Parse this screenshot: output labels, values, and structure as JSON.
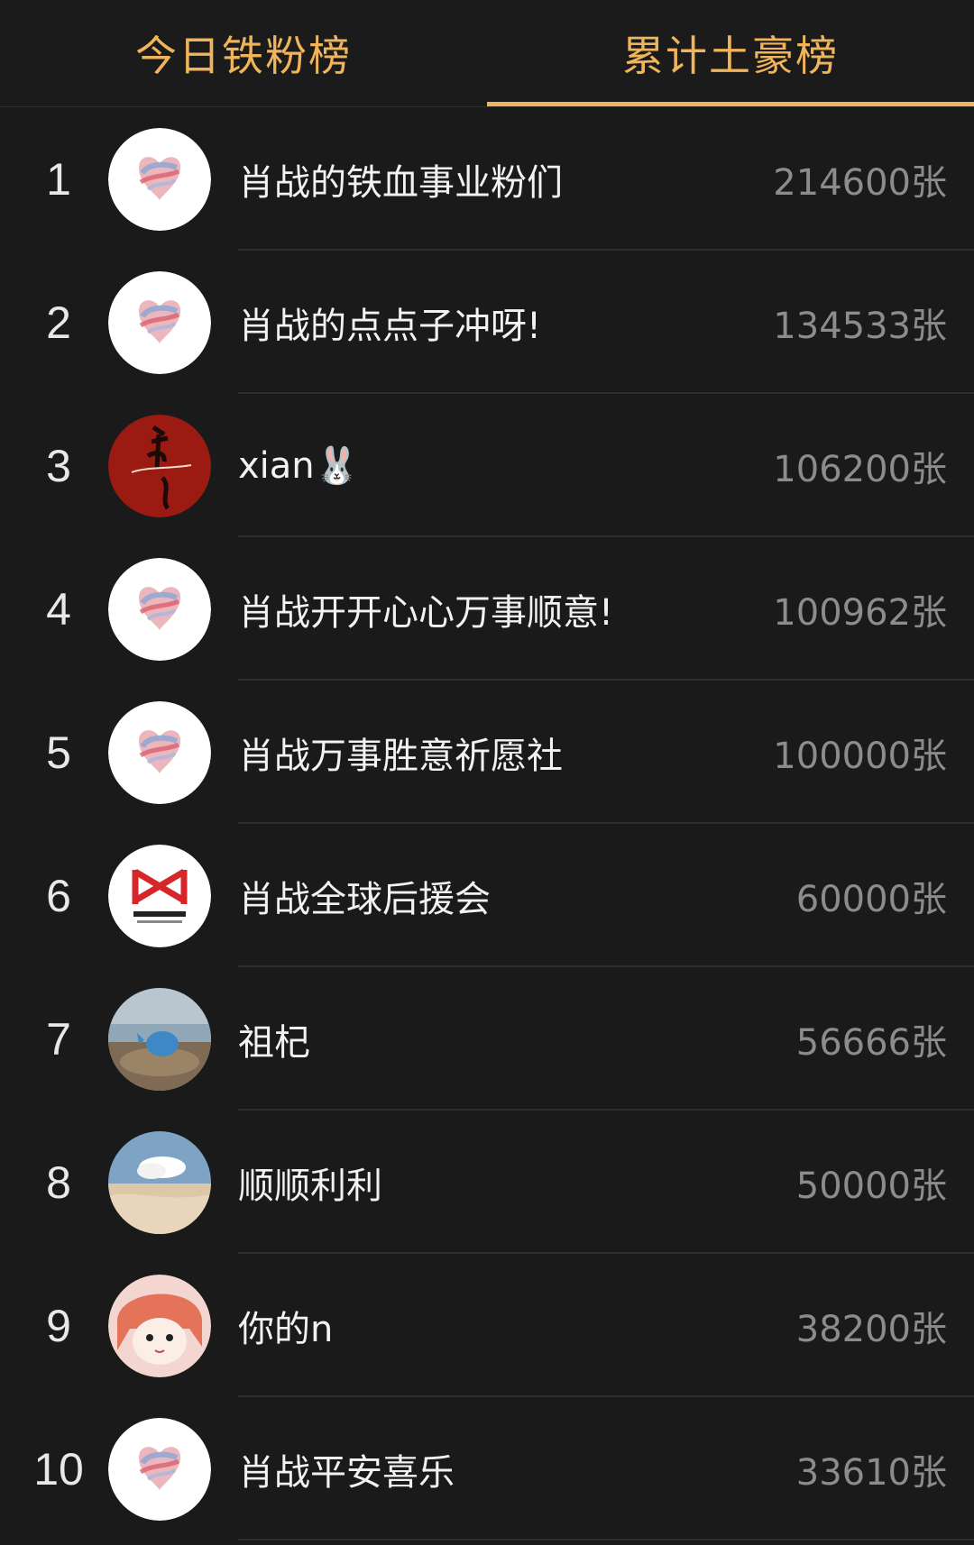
{
  "tabs": [
    {
      "label": "今日铁粉榜",
      "active": false
    },
    {
      "label": "累计土豪榜",
      "active": true
    }
  ],
  "colors": {
    "accent": "#f0b55a",
    "background": "#1a1a1a",
    "name_text": "#f2f2f2",
    "amount_text": "#8c8c8c"
  },
  "rows": [
    {
      "rank": "1",
      "name": "肖战的铁血事业粉们",
      "amount": "214600张",
      "avatar": "heart-logo-avatar"
    },
    {
      "rank": "2",
      "name": "肖战的点点子冲呀!",
      "amount": "134533张",
      "avatar": "heart-logo-avatar"
    },
    {
      "rank": "3",
      "name": "xian🐰",
      "amount": "106200张",
      "avatar": "red-calligraphy-avatar"
    },
    {
      "rank": "4",
      "name": "肖战开开心心万事顺意!",
      "amount": "100962张",
      "avatar": "heart-logo-avatar"
    },
    {
      "rank": "5",
      "name": "肖战万事胜意祈愿社",
      "amount": "100000张",
      "avatar": "heart-logo-avatar"
    },
    {
      "rank": "6",
      "name": "肖战全球后援会",
      "amount": "60000张",
      "avatar": "fanclub-logo-avatar"
    },
    {
      "rank": "7",
      "name": "祖杞",
      "amount": "56666张",
      "avatar": "whale-photo-avatar"
    },
    {
      "rank": "8",
      "name": "顺顺利利",
      "amount": "50000张",
      "avatar": "cloud-photo-avatar"
    },
    {
      "rank": "9",
      "name": "你的n",
      "amount": "38200张",
      "avatar": "anime-girl-avatar"
    },
    {
      "rank": "10",
      "name": "肖战平安喜乐",
      "amount": "33610张",
      "avatar": "heart-logo-avatar"
    }
  ]
}
